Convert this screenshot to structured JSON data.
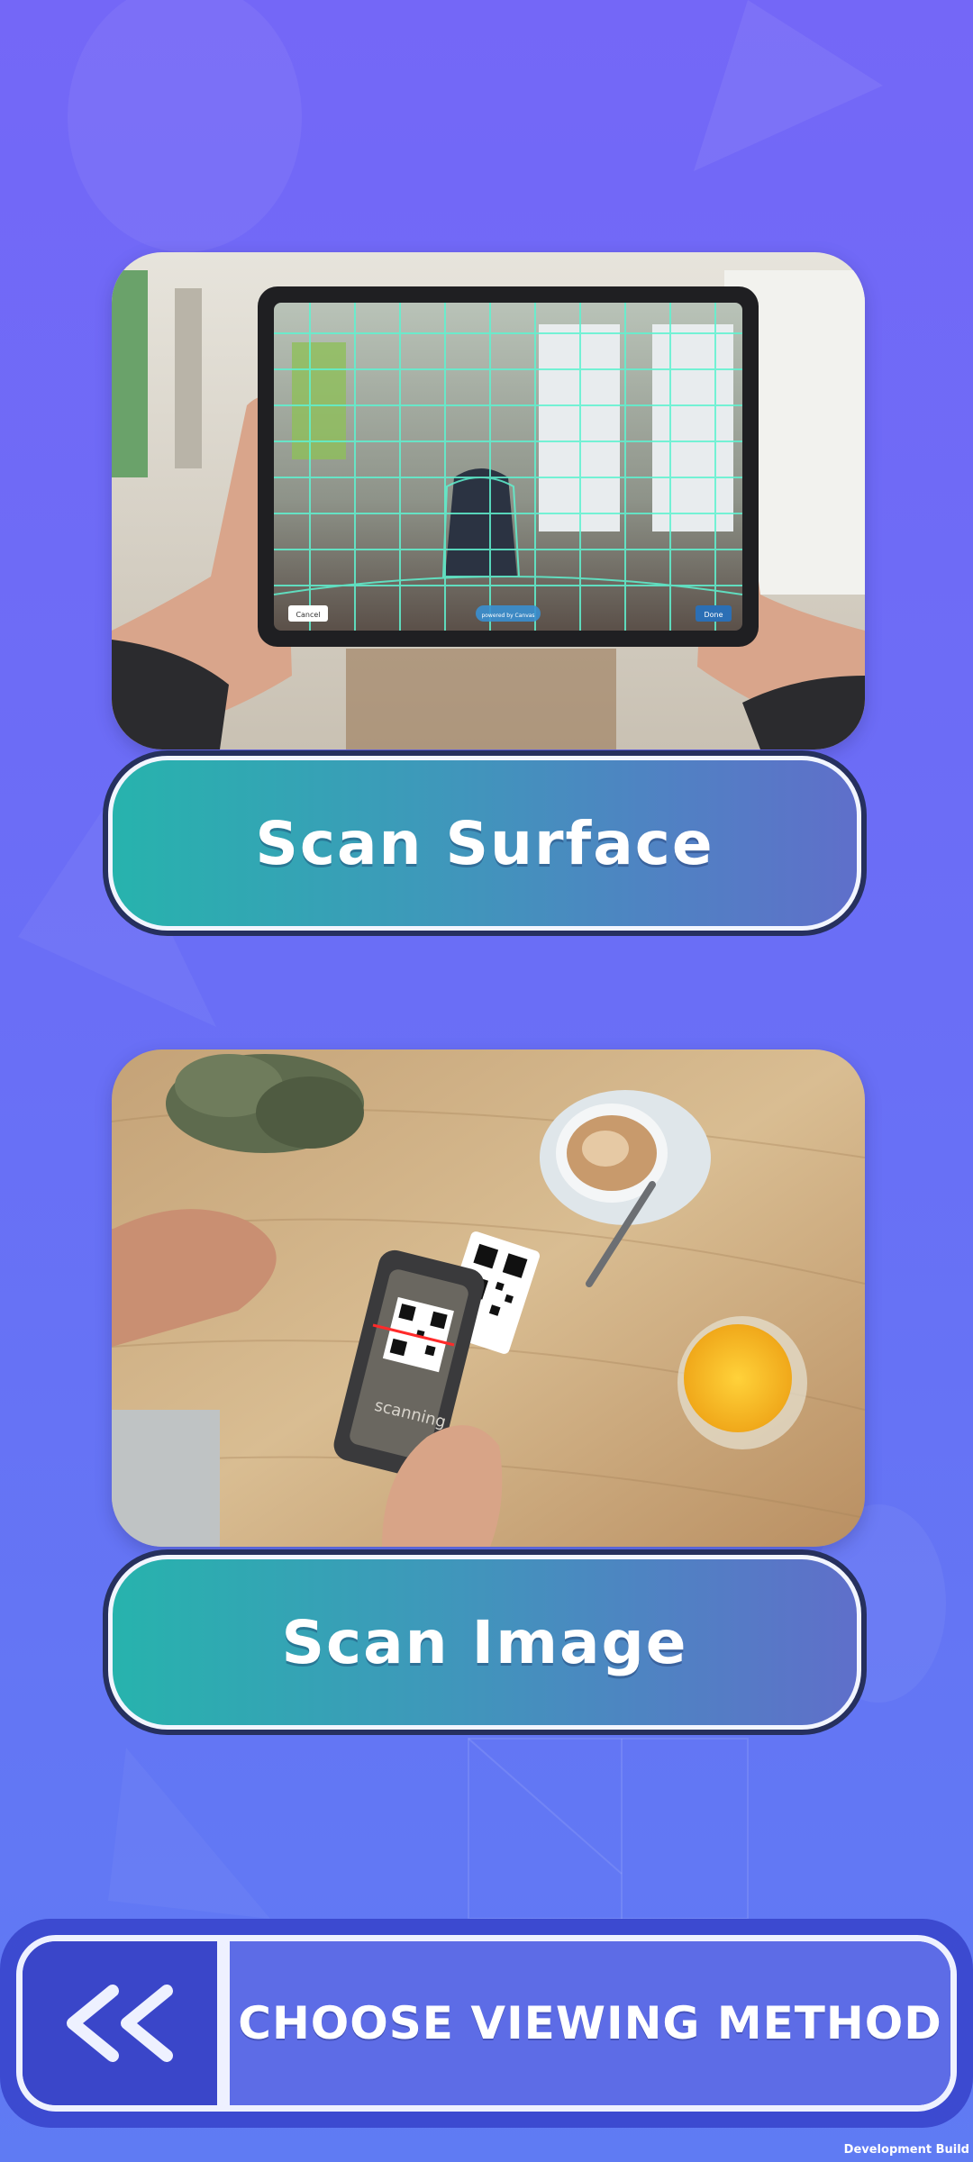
{
  "theme": {
    "background_top": "#7467f7",
    "background_bottom": "#5f7bf3",
    "button_gradient_start": "#27b3ad",
    "button_gradient_end": "#5f6fca",
    "button_outline": "#26305e",
    "bar_color": "#3c4ad0"
  },
  "options": [
    {
      "image": "tablet-room-scan-photo",
      "label": "Scan Surface",
      "image_text": {
        "cancel": "Cancel",
        "powered": "powered by Canvas",
        "done": "Done"
      }
    },
    {
      "image": "phone-qr-scan-photo",
      "label": "Scan Image",
      "image_text": {
        "scanning": "scanning"
      }
    }
  ],
  "bottom_bar": {
    "back_icon": "double-chevron-left-icon",
    "title": "CHOOSE VIEWING METHOD"
  },
  "build_label": "Development Build"
}
